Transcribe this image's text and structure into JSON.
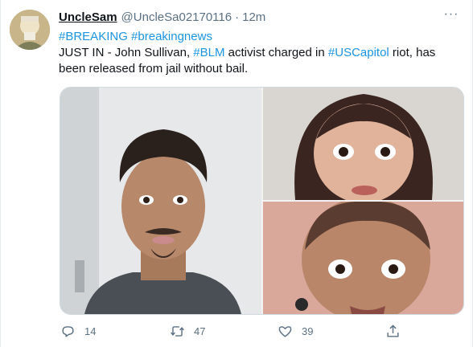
{
  "tweet": {
    "display_name": "UncleSam",
    "handle": "@UncleSa02170116",
    "separator": "·",
    "time": "12m",
    "more_label": "···",
    "hashtags_line": {
      "tag1": "#BREAKING",
      "tag2": "#breakingnews"
    },
    "body": {
      "part1": "JUST IN - John Sullivan, ",
      "tag_blm": "#BLM",
      "part2": " activist charged in ",
      "tag_capitol": "#USCapitol",
      "part3": " riot, has",
      "line3": "been released from jail without bail."
    }
  },
  "media": {
    "count": 3
  },
  "actions": {
    "reply_count": "14",
    "retweet_count": "47",
    "like_count": "39"
  },
  "colors": {
    "link": "#1b95e0",
    "muted": "#5b7083",
    "text": "#0f1419",
    "border": "#cfd9de"
  },
  "icons": {
    "reply": "reply-icon",
    "retweet": "retweet-icon",
    "like": "heart-icon",
    "share": "share-icon",
    "more": "more-icon"
  }
}
